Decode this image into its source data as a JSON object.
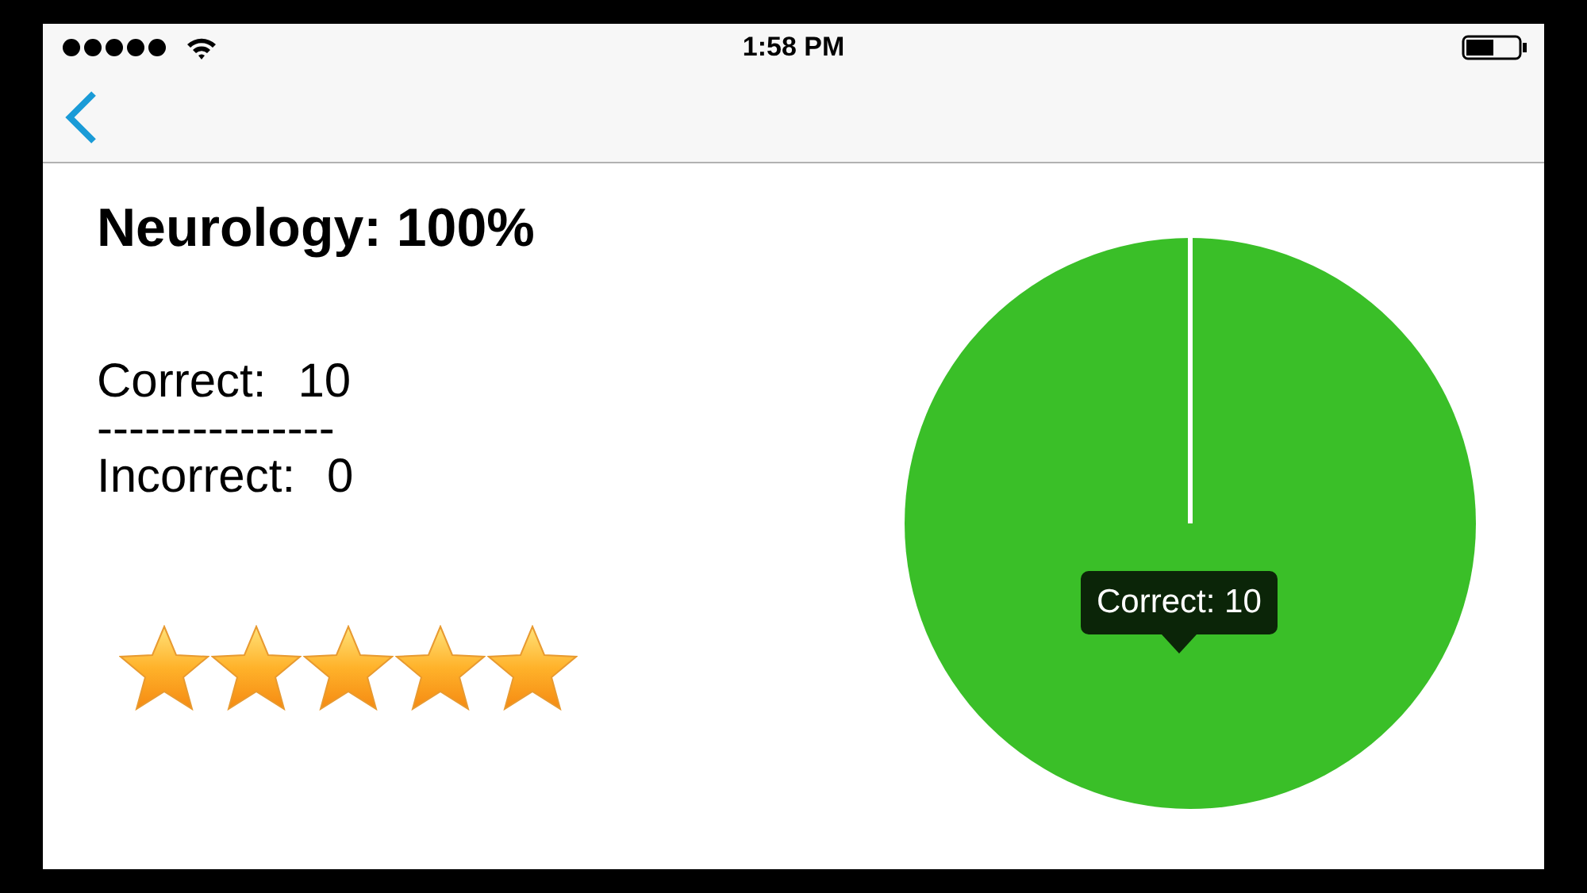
{
  "status_bar": {
    "time": "1:58 PM"
  },
  "summary": {
    "title": "Neurology: 100%",
    "correct_label": "Correct:",
    "correct_value": "10",
    "divider": "---------------",
    "incorrect_label": "Incorrect:",
    "incorrect_value": "0",
    "stars": 5
  },
  "chart": {
    "tooltip": "Correct: 10"
  }
}
